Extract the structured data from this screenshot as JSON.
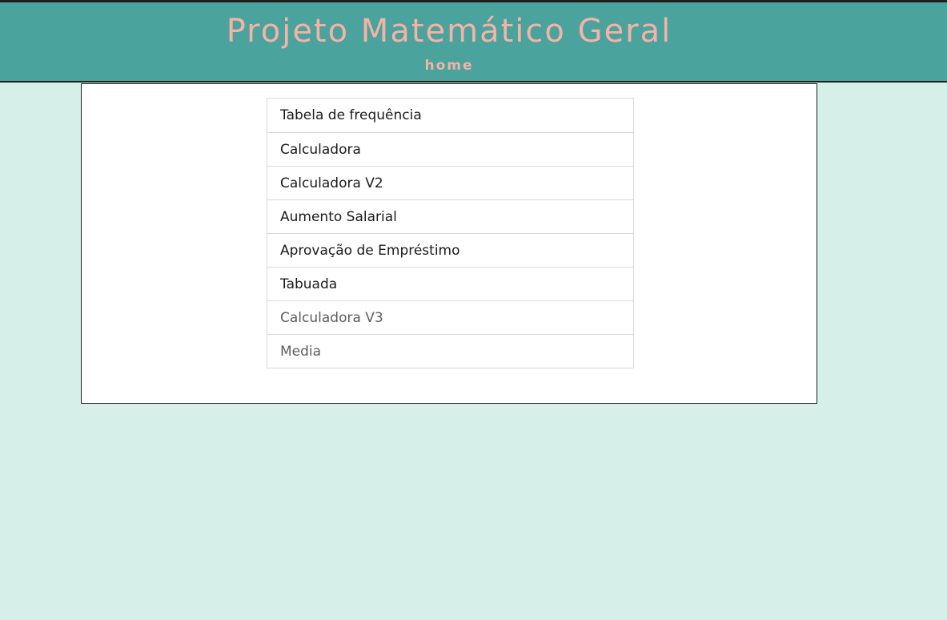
{
  "header": {
    "title": "Projeto Matemático Geral",
    "subtitle": "home"
  },
  "colors": {
    "page_bg": "#d7efe9",
    "header_bg": "#4aa39c",
    "header_text": "#f4b3a7",
    "panel_bg": "#ffffff",
    "list_border": "#d9d9d9",
    "text_primary": "#1b1b1b",
    "text_muted": "#5d5d5d"
  },
  "menu": {
    "items": [
      {
        "label": "Tabela de frequência"
      },
      {
        "label": "Calculadora"
      },
      {
        "label": "Calculadora V2"
      },
      {
        "label": "Aumento Salarial"
      },
      {
        "label": "Aprovação de Empréstimo"
      },
      {
        "label": "Tabuada"
      },
      {
        "label": "Calculadora V3"
      },
      {
        "label": "Media"
      }
    ]
  }
}
